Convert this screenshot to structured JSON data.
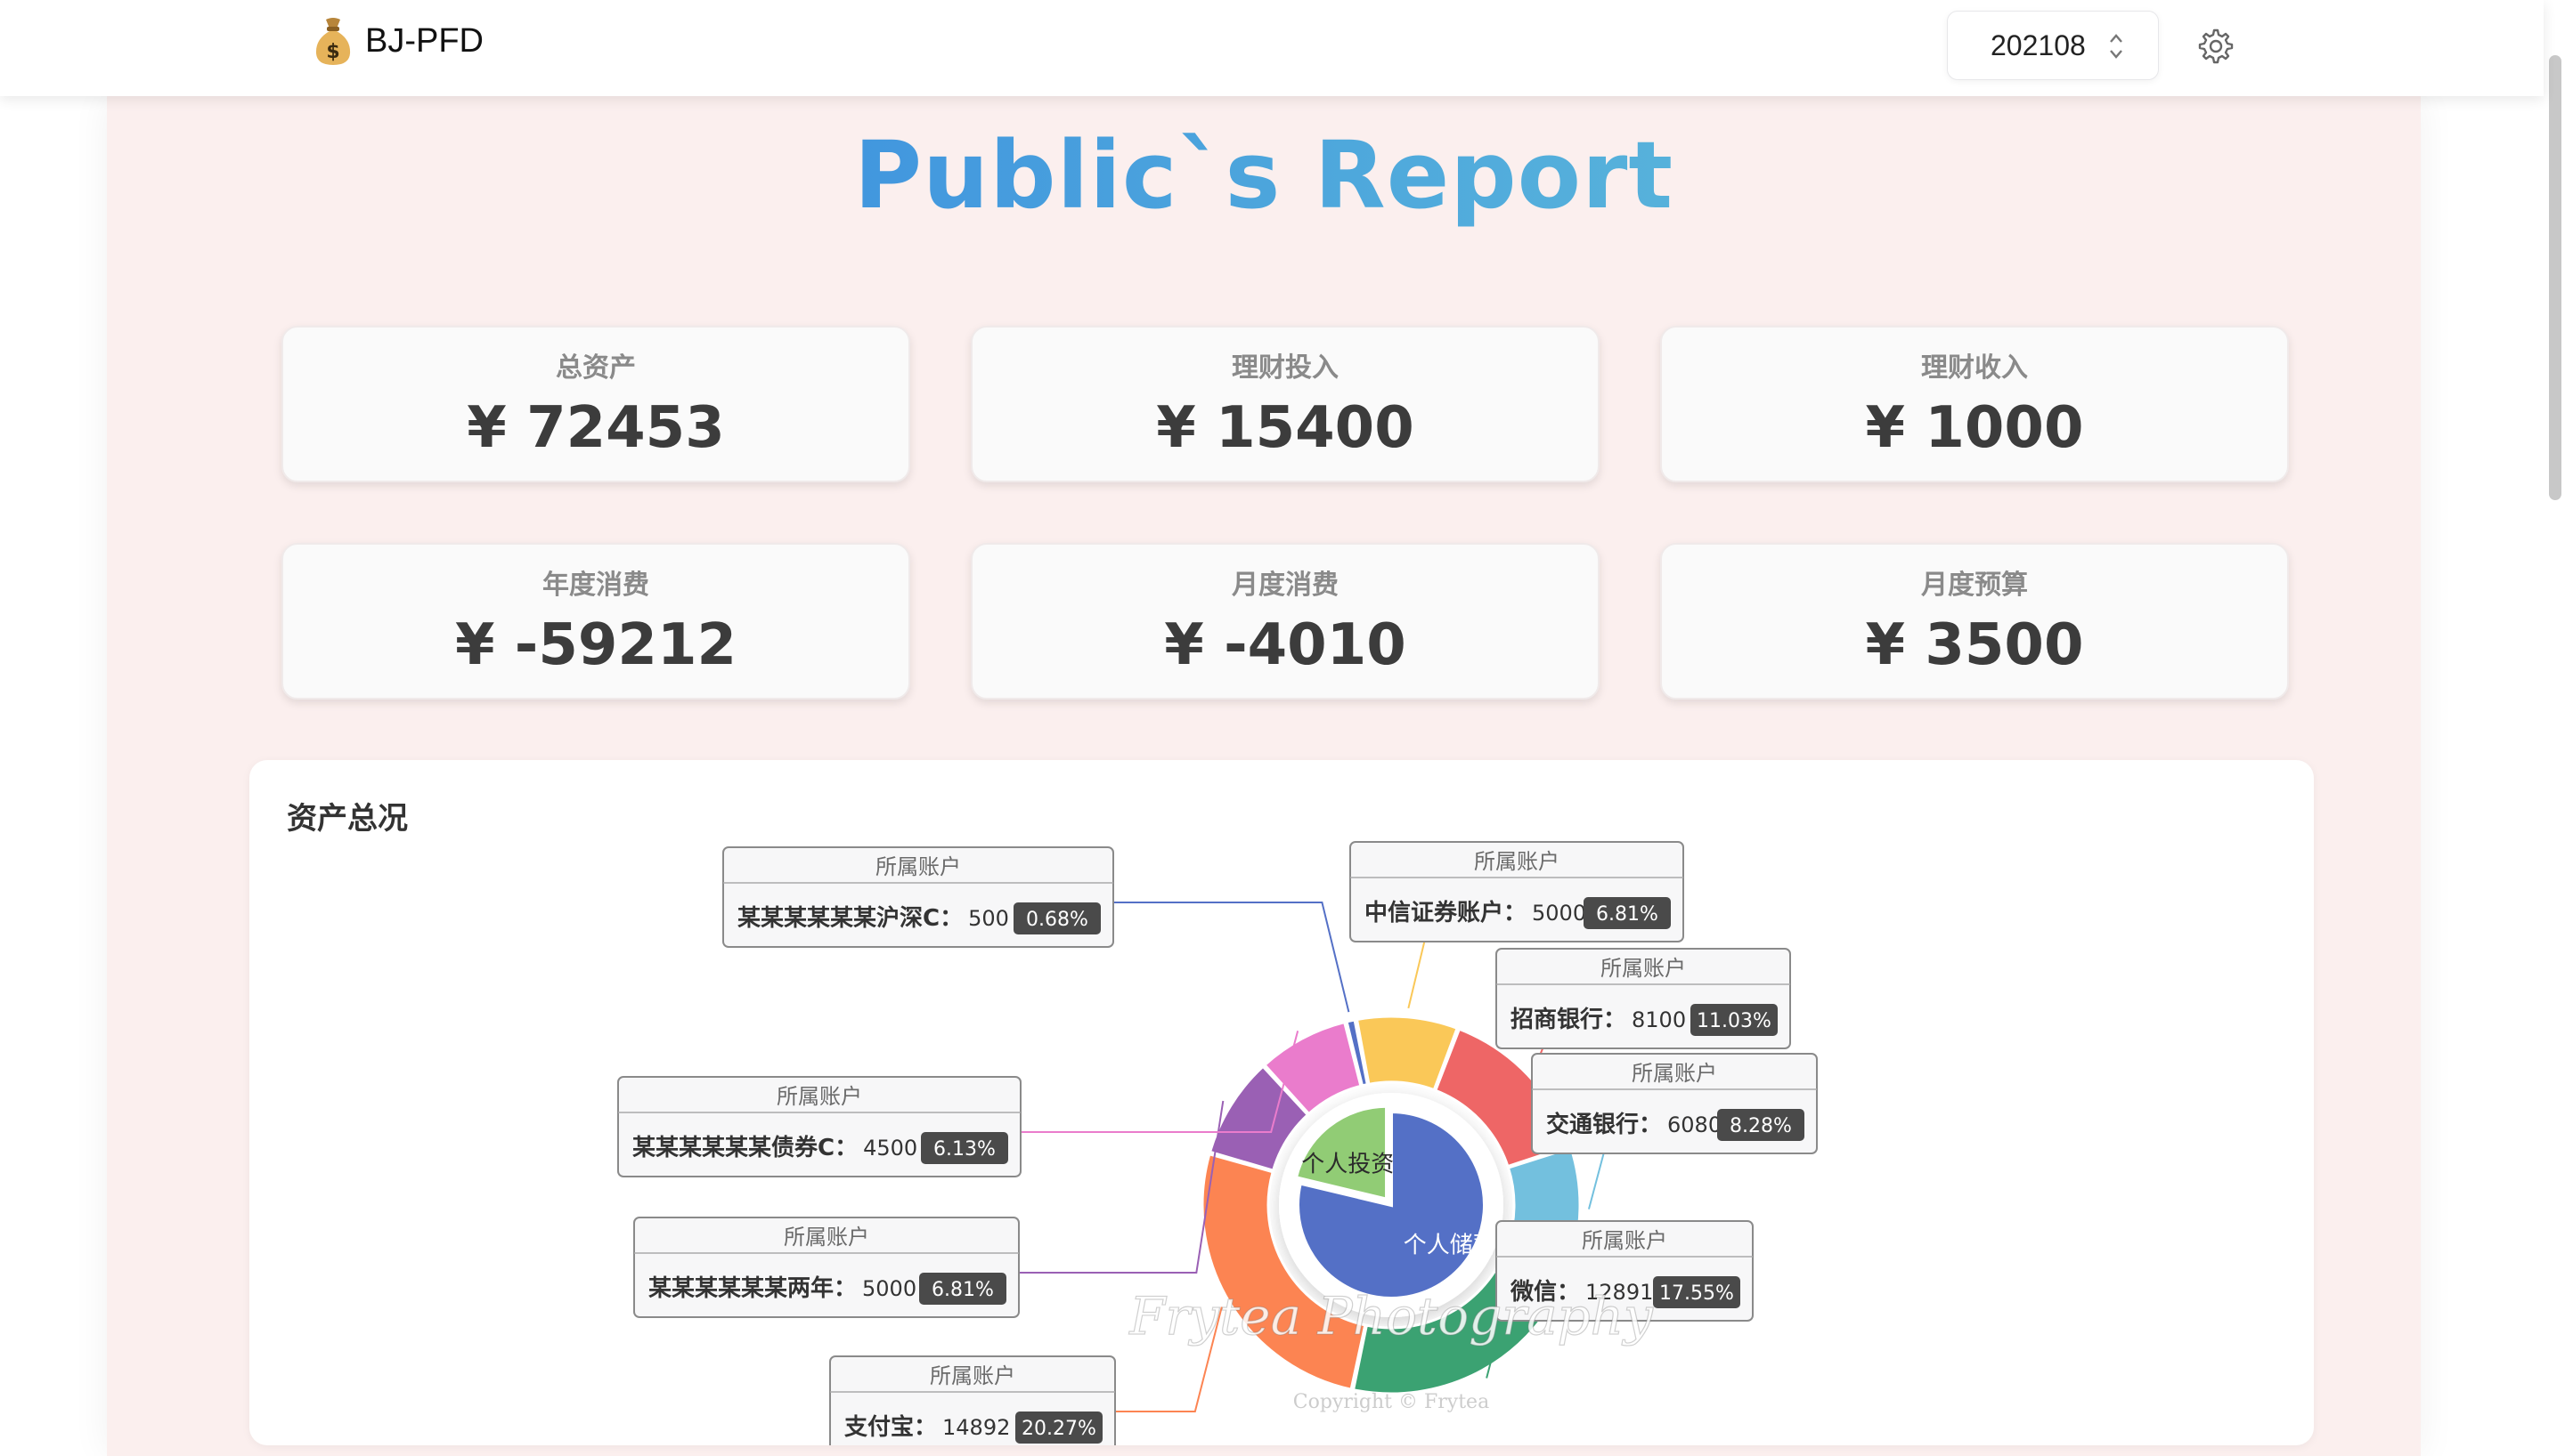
{
  "app": {
    "title": "BJ-PFD",
    "logo_icon": "money-bag-icon"
  },
  "header": {
    "month": "202108",
    "settings_icon": "gear-icon"
  },
  "report_title": "Public`s Report",
  "cards": [
    {
      "label": "总资产",
      "value": "¥ 72453"
    },
    {
      "label": "理财投入",
      "value": "¥ 15400"
    },
    {
      "label": "理财收入",
      "value": "¥ 1000"
    },
    {
      "label": "年度消费",
      "value": "¥ -59212"
    },
    {
      "label": "月度消费",
      "value": "¥ -4010"
    },
    {
      "label": "月度预算",
      "value": "¥ 3500"
    }
  ],
  "asset_panel": {
    "title": "资产总况"
  },
  "chart_data": {
    "type": "pie",
    "inner": {
      "slices": [
        {
          "name": "个人储蓄",
          "value": 57053,
          "color": "#5470c6"
        },
        {
          "name": "个人投资",
          "value": 15400,
          "color": "#91cc75"
        }
      ]
    },
    "outer": {
      "header": "所属账户",
      "slices": [
        {
          "name": "中信证券账户",
          "value": 5000,
          "percent": "6.81%",
          "color": "#fac858"
        },
        {
          "name": "招商银行",
          "value": 8100,
          "percent": "11.03%",
          "color": "#ee6666"
        },
        {
          "name": "交通银行",
          "value": 6080,
          "percent": "8.28%",
          "color": "#73c0de"
        },
        {
          "name": "微信",
          "value": 12891,
          "percent": "17.55%",
          "color": "#3ba272"
        },
        {
          "name": "支付宝",
          "value": 14892,
          "percent": "20.27%",
          "color": "#fc8452"
        },
        {
          "name": "某某某某某某两年",
          "value": 5000,
          "percent": "6.81%",
          "color": "#9a60b4"
        },
        {
          "name": "某某某某某某债券C",
          "value": 4500,
          "percent": "6.13%",
          "color": "#ea7ccc"
        },
        {
          "name": "某某某某某某沪深C",
          "value": 500,
          "percent": "0.68%",
          "color": "#5470c6"
        }
      ]
    }
  },
  "watermark": {
    "text": "Frytea Photography",
    "copyright": "Copyright © Frytea"
  }
}
